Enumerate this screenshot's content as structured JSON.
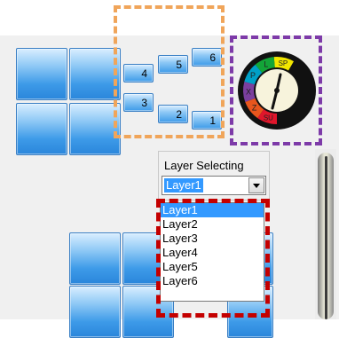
{
  "orange_tiles": [
    {
      "label": "4"
    },
    {
      "label": "5"
    },
    {
      "label": "6"
    },
    {
      "label": "3"
    },
    {
      "label": "2"
    },
    {
      "label": "1"
    }
  ],
  "clock": {
    "segments": [
      {
        "label": "SP",
        "color": "#f2e600"
      },
      {
        "label": "L",
        "color": "#13a538"
      },
      {
        "label": "P",
        "color": "#00a0c8"
      },
      {
        "label": "X",
        "color": "#7b3f9e"
      },
      {
        "label": "Z",
        "color": "#e8561d"
      },
      {
        "label": "SU",
        "color": "#e0162b"
      }
    ],
    "ring_color": "#111111",
    "face_color": "#f7f3dc"
  },
  "layer_selecting": {
    "title": "Layer Selecting",
    "current": "Layer1",
    "options": [
      "Layer1",
      "Layer2",
      "Layer3",
      "Layer4",
      "Layer5",
      "Layer6"
    ]
  },
  "colors": {
    "orange_dash": "#f0a55a",
    "purple_dash": "#7d3aa8",
    "red_dash": "#c40000",
    "selection": "#3399ff"
  }
}
